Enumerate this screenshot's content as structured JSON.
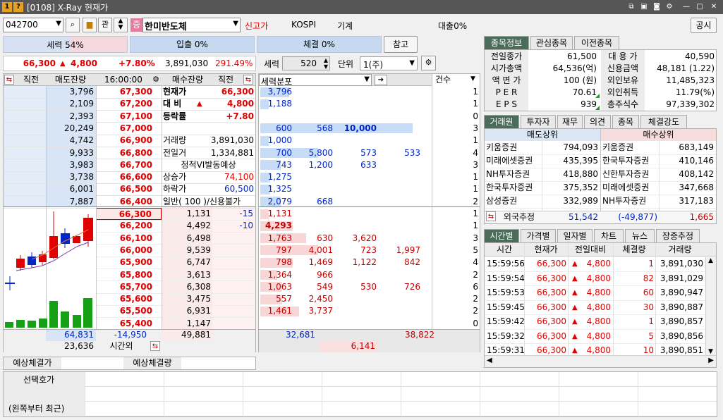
{
  "window": {
    "title": "[0108] X-Ray 현재가",
    "badge1": "1",
    "badge2": "?"
  },
  "toolbar": {
    "code": "042700",
    "kwan": "관",
    "jeung": "증",
    "name": "한미반도체",
    "sin_gogga": "신고가",
    "market": "KOSPI",
    "sector": "기계",
    "loan": "대출0%",
    "notice": "공시"
  },
  "strength": {
    "sell": "세력 54%",
    "inflow": "입출 0%",
    "trade": "체결 0%",
    "ref": "참고"
  },
  "summary": {
    "price": "66,300",
    "change": "4,800",
    "pct": "+7.80%",
    "volume": "3,891,030",
    "ratio": "291.49%",
    "force_label": "세력",
    "force_val": "520",
    "unit_label": "단위",
    "unit_val": "1(주)"
  },
  "orderbook": {
    "headers": [
      "직전",
      "매도잔량",
      "16:00:00",
      "매수잔량",
      "직전"
    ],
    "asks": [
      {
        "qty": "3,796",
        "price": "67,300"
      },
      {
        "qty": "2,109",
        "price": "67,200"
      },
      {
        "qty": "2,393",
        "price": "67,100"
      },
      {
        "qty": "20,249",
        "price": "67,000"
      },
      {
        "qty": "4,742",
        "price": "66,900"
      },
      {
        "qty": "9,933",
        "price": "66,800"
      },
      {
        "qty": "3,983",
        "price": "66,700"
      },
      {
        "qty": "3,738",
        "price": "66,600"
      },
      {
        "qty": "6,001",
        "price": "66,500"
      },
      {
        "qty": "7,887",
        "price": "66,400"
      }
    ],
    "bids": [
      {
        "price": "66,300",
        "qty": "1,131",
        "prev": "-15"
      },
      {
        "price": "66,200",
        "qty": "4,492",
        "prev": "-10"
      },
      {
        "price": "66,100",
        "qty": "6,498",
        "prev": ""
      },
      {
        "price": "66,000",
        "qty": "9,539",
        "prev": ""
      },
      {
        "price": "65,900",
        "qty": "6,747",
        "prev": ""
      },
      {
        "price": "65,800",
        "qty": "3,613",
        "prev": ""
      },
      {
        "price": "65,700",
        "qty": "6,308",
        "prev": ""
      },
      {
        "price": "65,600",
        "qty": "3,475",
        "prev": ""
      },
      {
        "price": "65,500",
        "qty": "6,931",
        "prev": ""
      },
      {
        "price": "65,400",
        "qty": "1,147",
        "prev": ""
      }
    ],
    "info": [
      {
        "label": "현재가",
        "value": "66,300"
      },
      {
        "label": "대 비",
        "value": "4,800"
      },
      {
        "label": "등락률",
        "value": "+7.80"
      },
      {
        "label": "",
        "value": ""
      },
      {
        "label": "거래량",
        "value": "3,891,030"
      },
      {
        "label": "전일거",
        "value": "1,334,881"
      },
      {
        "label": "정적VI발동예상",
        "value": ""
      },
      {
        "label": "상승가",
        "value": "74,100"
      },
      {
        "label": "하락가",
        "value": "60,500"
      },
      {
        "label": "일반( 100 )/신용불가",
        "value": ""
      }
    ],
    "total_ask": "64,831",
    "total_diff": "-14,950",
    "total_bid": "49,881",
    "after_qty": "23,636",
    "after_label": "시간외"
  },
  "distribution": {
    "title": "세력분포",
    "count_header": "건수",
    "asks": [
      {
        "v": [
          "3,796",
          "",
          "",
          ""
        ],
        "n": "1",
        "w": 0.17
      },
      {
        "v": [
          "1,188",
          "",
          "",
          ""
        ],
        "n": "1",
        "w": 0.05
      },
      {
        "v": [
          "",
          "",
          "",
          ""
        ],
        "n": "0",
        "w": 0
      },
      {
        "v": [
          "600",
          "568",
          "10,000",
          ""
        ],
        "n": "3",
        "w": 0.9
      },
      {
        "v": [
          "1,000",
          "",
          "",
          ""
        ],
        "n": "1",
        "w": 0.05
      },
      {
        "v": [
          "700",
          "5,800",
          "573",
          "533"
        ],
        "n": "4",
        "w": 0.34
      },
      {
        "v": [
          "743",
          "1,200",
          "633",
          ""
        ],
        "n": "3",
        "w": 0.12
      },
      {
        "v": [
          "1,275",
          "",
          "",
          ""
        ],
        "n": "1",
        "w": 0.06
      },
      {
        "v": [
          "1,325",
          "",
          "",
          ""
        ],
        "n": "1",
        "w": 0.06
      },
      {
        "v": [
          "2,079",
          "668",
          "",
          ""
        ],
        "n": "2",
        "w": 0.12
      }
    ],
    "bids": [
      {
        "v": [
          "1,131",
          "",
          "",
          ""
        ],
        "n": "1",
        "w": 0.05
      },
      {
        "v": [
          "4,293",
          "",
          "",
          ""
        ],
        "n": "1",
        "w": 0.19
      },
      {
        "v": [
          "1,763",
          "630",
          "3,620",
          ""
        ],
        "n": "3",
        "w": 0.27
      },
      {
        "v": [
          "797",
          "4,001",
          "723",
          "1,997"
        ],
        "n": "5",
        "w": 0.34
      },
      {
        "v": [
          "798",
          "1,469",
          "1,122",
          "842"
        ],
        "n": "4",
        "w": 0.19
      },
      {
        "v": [
          "1,364",
          "966",
          "",
          ""
        ],
        "n": "2",
        "w": 0.1
      },
      {
        "v": [
          "1,063",
          "549",
          "530",
          "726"
        ],
        "n": "6",
        "w": 0.13
      },
      {
        "v": [
          "557",
          "2,450",
          "",
          ""
        ],
        "n": "2",
        "w": 0.13
      },
      {
        "v": [
          "1,461",
          "3,737",
          "",
          ""
        ],
        "n": "2",
        "w": 0.23
      },
      {
        "v": [
          "",
          "",
          "",
          ""
        ],
        "n": "0",
        "w": 0
      }
    ],
    "total_ask": "32,681",
    "total_bid": "38,822",
    "diff": "6,141"
  },
  "expected": {
    "price_label": "예상체결가",
    "qty_label": "예상체결량"
  },
  "select_quote": {
    "label": "선택호가",
    "sub": "(왼쪽부터 최근)"
  },
  "stock_info": {
    "tabs": [
      "종목정보",
      "관심종목",
      "이전종목"
    ],
    "rows": [
      {
        "l": "전일종가",
        "v": "61,500",
        "l2": "대 용 가",
        "v2": "40,590"
      },
      {
        "l": "시가총액",
        "v": "64,536(억)",
        "l2": "신용금액",
        "v2": "48,181  (1.22)"
      },
      {
        "l": "액 면 가",
        "v": "100 (원)",
        "l2": "외인보유",
        "v2": "11,485,323"
      },
      {
        "l": "P E R",
        "v": "70.61",
        "l2": "외인취득",
        "v2": "11.79(%)"
      },
      {
        "l": "E P S",
        "v": "939",
        "l2": "총주식수",
        "v2": "97,339,302"
      }
    ]
  },
  "broker": {
    "tabs": [
      "거래원",
      "투자자",
      "재무",
      "의견",
      "종목",
      "체결강도"
    ],
    "sell_header": "매도상위",
    "buy_header": "매수상위",
    "rows": [
      {
        "sn": "키움증권",
        "sq": "794,093",
        "bn": "키움증권",
        "bq": "683,149"
      },
      {
        "sn": "미래에셋증권",
        "sq": "435,395",
        "bn": "한국투자증권",
        "bq": "410,146"
      },
      {
        "sn": "NH투자증권",
        "sq": "418,880",
        "bn": "신한투자증권",
        "bq": "408,142"
      },
      {
        "sn": "한국투자증권",
        "sq": "375,352",
        "bn": "미래에셋증권",
        "bq": "347,668"
      },
      {
        "sn": "삼성증권",
        "sq": "332,989",
        "bn": "NH투자증권",
        "bq": "317,183"
      }
    ],
    "foreign_label": "외국추정",
    "foreign_sell": "51,542",
    "foreign_net": "(-49,877)",
    "foreign_buy": "1,665"
  },
  "ticks": {
    "tabs": [
      "시간별",
      "가격별",
      "일자별",
      "차트",
      "뉴스",
      "장중추정"
    ],
    "headers": [
      "시간",
      "현재가",
      "전일대비",
      "체결량",
      "거래량"
    ],
    "rows": [
      {
        "t": "15:59:56",
        "p": "66,300",
        "d": "4,800",
        "q": "1",
        "v": "3,891,030"
      },
      {
        "t": "15:59:54",
        "p": "66,300",
        "d": "4,800",
        "q": "82",
        "v": "3,891,029"
      },
      {
        "t": "15:59:53",
        "p": "66,300",
        "d": "4,800",
        "q": "60",
        "v": "3,890,947"
      },
      {
        "t": "15:59:45",
        "p": "66,300",
        "d": "4,800",
        "q": "30",
        "v": "3,890,887"
      },
      {
        "t": "15:59:42",
        "p": "66,300",
        "d": "4,800",
        "q": "1",
        "v": "3,890,857"
      },
      {
        "t": "15:59:32",
        "p": "66,300",
        "d": "4,800",
        "q": "5",
        "v": "3,890,856"
      },
      {
        "t": "15:59:31",
        "p": "66,300",
        "d": "4,800",
        "q": "10",
        "v": "3,890,851"
      }
    ]
  },
  "colors": {
    "up": "#e00000",
    "down": "#0026c8",
    "tab_selected": "#4b6b5b",
    "title_bar": "#565656"
  }
}
